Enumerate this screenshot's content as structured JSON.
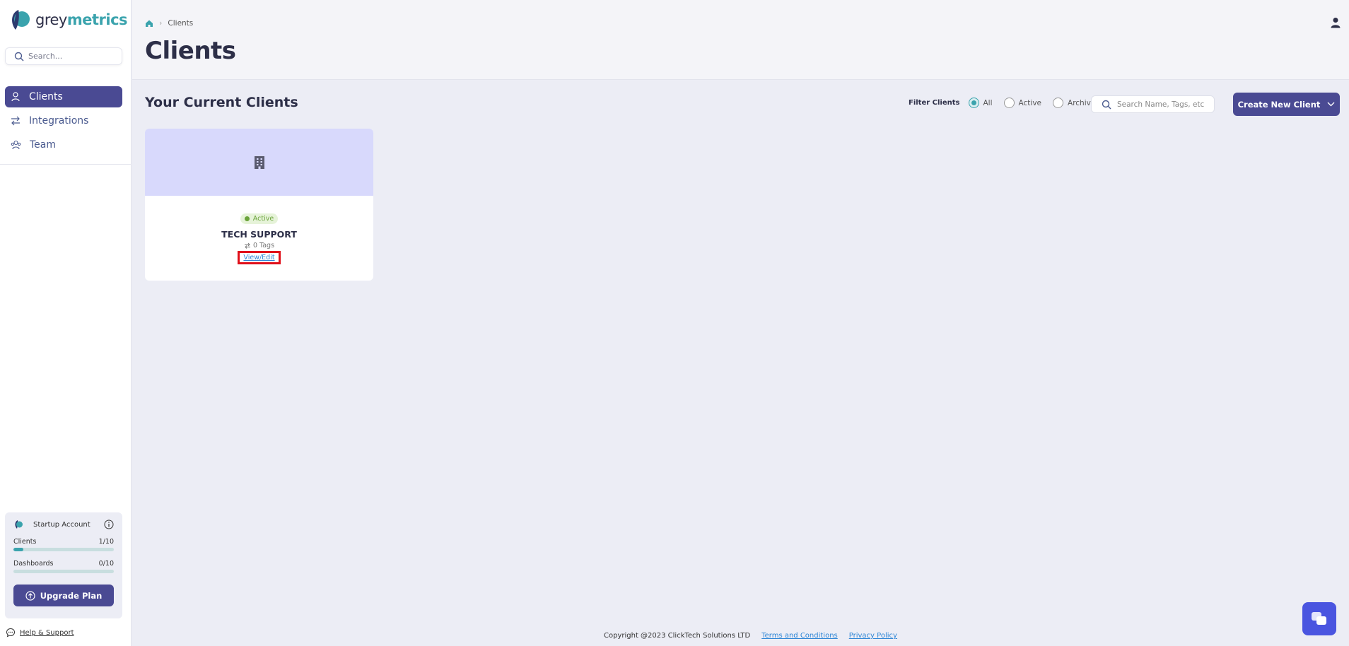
{
  "brand": {
    "name_part1": "grey",
    "name_part2": "metrics"
  },
  "sidebar": {
    "search_placeholder": "Search...",
    "items": [
      {
        "label": "Clients",
        "icon": "user-icon",
        "active": true
      },
      {
        "label": "Integrations",
        "icon": "arrows-icon",
        "active": false
      },
      {
        "label": "Team",
        "icon": "team-icon",
        "active": false
      }
    ],
    "account": {
      "title": "Startup Account",
      "usage": [
        {
          "label": "Clients",
          "value": "1/10",
          "fraction": 0.1
        },
        {
          "label": "Dashboards",
          "value": "0/10",
          "fraction": 0
        }
      ],
      "upgrade_label": "Upgrade Plan"
    },
    "help_label": "Help & Support"
  },
  "header": {
    "breadcrumb": {
      "current": "Clients"
    },
    "title": "Clients"
  },
  "main": {
    "section_title": "Your Current Clients",
    "filter": {
      "label": "Filter Clients",
      "options": [
        {
          "label": "All",
          "selected": true
        },
        {
          "label": "Active",
          "selected": false
        },
        {
          "label": "Archived",
          "selected": false
        }
      ]
    },
    "search_placeholder": "Search Name, Tags, etc",
    "create_label": "Create New Client",
    "clients": [
      {
        "status": "Active",
        "name": "TECH SUPPORT",
        "tags": "0 Tags",
        "action": "View/Edit"
      }
    ]
  },
  "footer": {
    "copyright": "Copyright @2023 ClickTech Solutions LTD",
    "terms": "Terms and Conditions",
    "privacy": "Privacy Policy"
  },
  "colors": {
    "primary": "#4a4a93",
    "accent": "#3aa3ad",
    "card_top": "#d8d9fc",
    "active": "#6aa33a",
    "highlight": "#e0101a"
  }
}
